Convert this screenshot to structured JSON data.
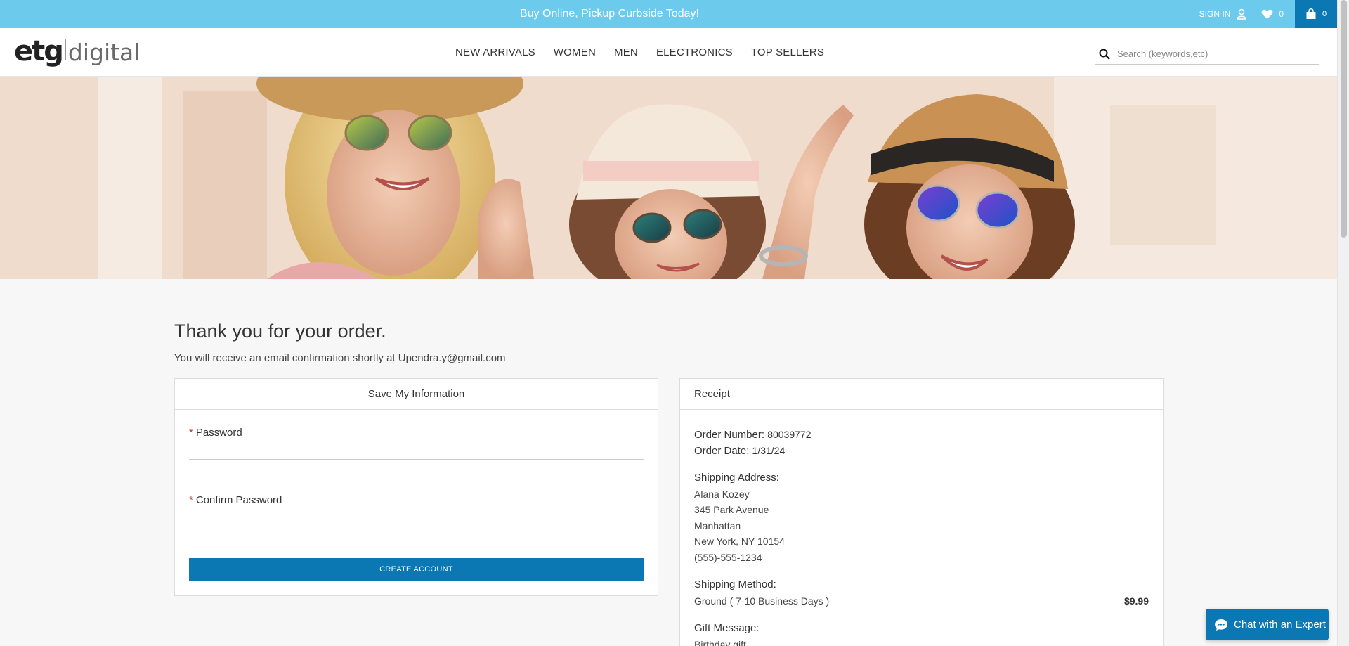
{
  "promo": {
    "text": "Buy Online, Pickup Curbside Today!"
  },
  "account": {
    "signin_label": "SIGN IN",
    "wishlist_count": "0",
    "cart_count": "0"
  },
  "logo": {
    "brand": "etg",
    "word": "digital"
  },
  "nav": [
    "NEW ARRIVALS",
    "WOMEN",
    "MEN",
    "ELECTRONICS",
    "TOP SELLERS"
  ],
  "search": {
    "placeholder": "Search (keywords,etc)"
  },
  "confirmation": {
    "title": "Thank you for your order.",
    "message": "You will receive an email confirmation shortly at Upendra.y@gmail.com"
  },
  "save_info": {
    "heading": "Save My Information",
    "password_label": "Password",
    "confirm_label": "Confirm Password",
    "button": "CREATE ACCOUNT"
  },
  "receipt": {
    "heading": "Receipt",
    "order_number_label": "Order Number:",
    "order_number": "80039772",
    "order_date_label": "Order Date:",
    "order_date": "1/31/24",
    "shipping_address_label": "Shipping Address:",
    "address_lines": [
      "Alana Kozey",
      "345 Park Avenue",
      "Manhattan",
      "New York, NY 10154",
      "(555)-555-1234"
    ],
    "shipping_method_label": "Shipping Method:",
    "shipping_method": "Ground ( 7-10 Business Days )",
    "shipping_price": "$9.99",
    "gift_message_label": "Gift Message:",
    "gift_message": "Birthday gift"
  },
  "chat": {
    "label": "Chat with an Expert"
  },
  "colors": {
    "promo": "#6ccbec",
    "primary": "#0b78b4",
    "required": "#c0392b"
  }
}
